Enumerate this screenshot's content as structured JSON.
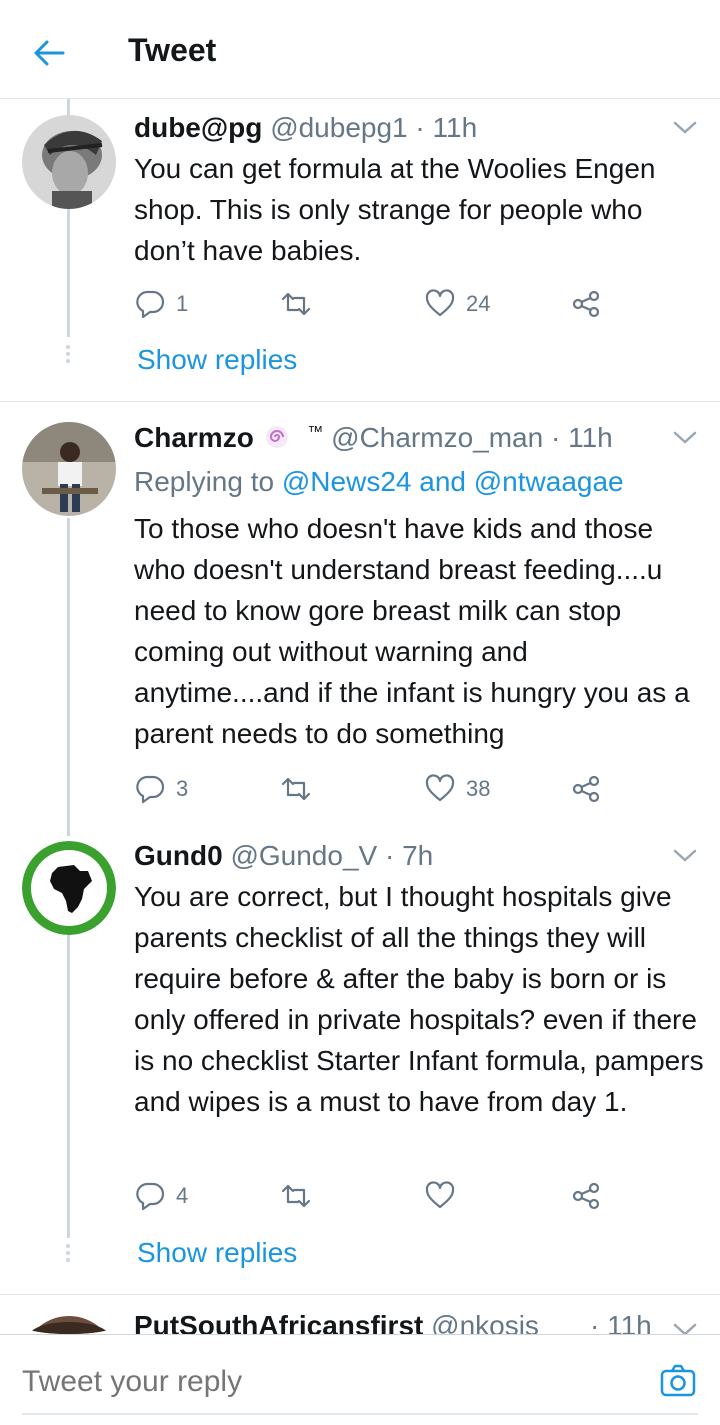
{
  "header": {
    "title": "Tweet"
  },
  "tweets": [
    {
      "name": "dube@pg",
      "handle": "@dubepg1 · 11h",
      "text": "You can get formula at the Woolies Engen shop. This is only strange for people who don’t have babies.",
      "replies": "1",
      "retweets": "",
      "likes": "24",
      "show_replies": "Show replies"
    },
    {
      "name": "Charmzo",
      "name_suffix": "™",
      "handle": "@Charmzo_man · 11h",
      "replying_prefix": "Replying to",
      "replying_user1": "@News24",
      "replying_and": "and",
      "replying_user2": "@ntwaagae",
      "text": "To those who doesn't have kids and those who doesn't understand breast feeding....u need to know gore breast milk can stop coming out without warning and anytime....and if the infant is hungry you as a parent needs to do something",
      "replies": "3",
      "retweets": "",
      "likes": "38"
    },
    {
      "name": "Gund0",
      "handle": "@Gundo_V · 7h",
      "text": "You are correct, but I thought hospitals give parents checklist of all the things they will require before & after the baby is born or is only offered in private hospitals? even if there is no checklist Starter Infant formula, pampers and wipes is a must to have from day 1.",
      "replies": "4",
      "retweets": "",
      "likes": "",
      "show_replies": "Show replies"
    },
    {
      "name": "PutSouthAfricansfirst",
      "handle": "@nkosis",
      "time": "· 11h"
    }
  ],
  "composer": {
    "placeholder": "Tweet your reply"
  },
  "colors": {
    "accent": "#1b95e0",
    "muted": "#657786",
    "text": "#14171a",
    "line": "#ccd6dd"
  }
}
